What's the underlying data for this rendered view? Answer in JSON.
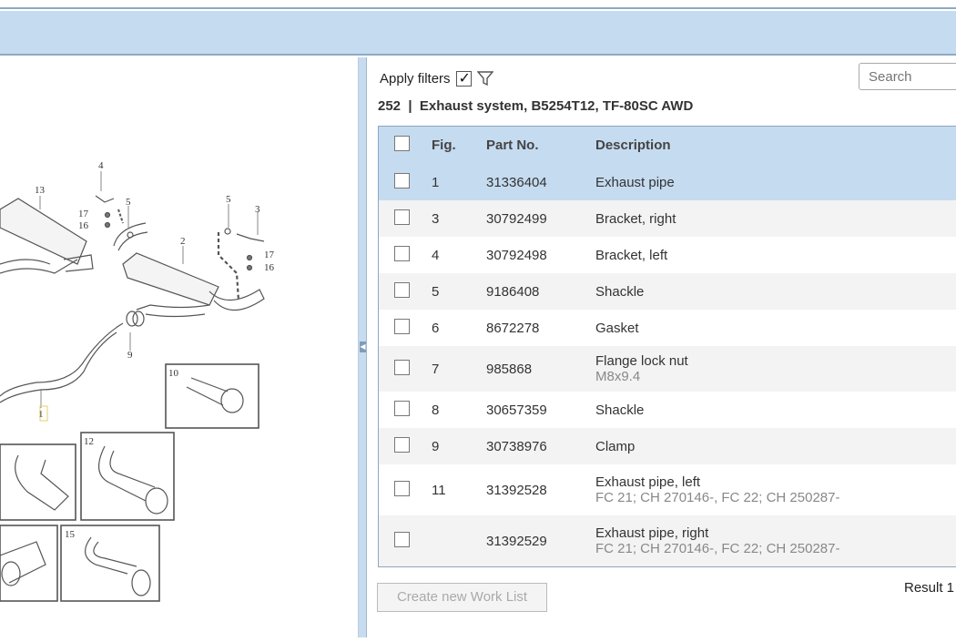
{
  "filters": {
    "label": "Apply filters",
    "checked": true
  },
  "search": {
    "placeholder": "Search"
  },
  "section_title": "252  |  Exhaust system, B5254T12, TF-80SC AWD",
  "table": {
    "headers": {
      "fig": "Fig.",
      "part": "Part No.",
      "description": "Description"
    },
    "rows": [
      {
        "fig": "1",
        "part": "31336404",
        "description": "Exhaust pipe",
        "sub": "",
        "selected": true
      },
      {
        "fig": "3",
        "part": "30792499",
        "description": "Bracket, right",
        "sub": ""
      },
      {
        "fig": "4",
        "part": "30792498",
        "description": "Bracket, left",
        "sub": ""
      },
      {
        "fig": "5",
        "part": "9186408",
        "description": "Shackle",
        "sub": ""
      },
      {
        "fig": "6",
        "part": "8672278",
        "description": "Gasket",
        "sub": ""
      },
      {
        "fig": "7",
        "part": "985868",
        "description": "Flange lock nut",
        "sub": "M8x9.4"
      },
      {
        "fig": "8",
        "part": "30657359",
        "description": "Shackle",
        "sub": ""
      },
      {
        "fig": "9",
        "part": "30738976",
        "description": "Clamp",
        "sub": ""
      },
      {
        "fig": "11",
        "part": "31392528",
        "description": "Exhaust pipe, left",
        "sub": "FC 21; CH 270146-, FC 22; CH 250287-"
      },
      {
        "fig": "",
        "part": "31392529",
        "description": "Exhaust pipe, right",
        "sub": "FC 21; CH 270146-, FC 22; CH 250287-"
      }
    ]
  },
  "buttons": {
    "create_work_list": "Create new Work List"
  },
  "result_text": "Result 1",
  "diagram": {
    "labels": [
      "13",
      "4",
      "5",
      "17",
      "16",
      "2",
      "5",
      "3",
      "17",
      "16",
      "9",
      "1",
      "10",
      "12",
      "15"
    ]
  }
}
